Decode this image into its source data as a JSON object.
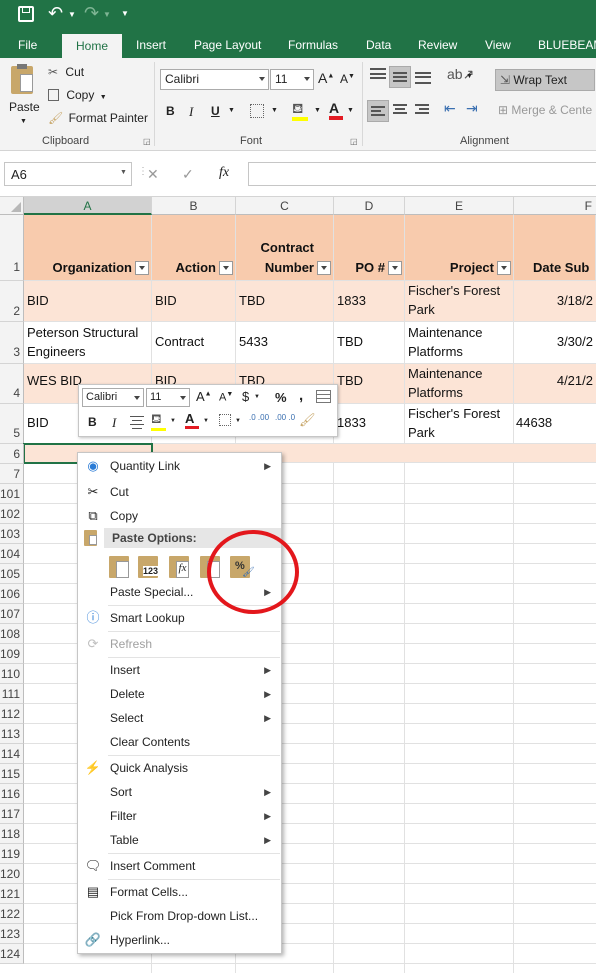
{
  "qat": {
    "save_icon": "save-icon",
    "undo_icon": "undo-icon",
    "redo_icon": "redo-icon",
    "customize_icon": "customize-icon"
  },
  "tabs": [
    "File",
    "Home",
    "Insert",
    "Page Layout",
    "Formulas",
    "Data",
    "Review",
    "View",
    "BLUEBEAM"
  ],
  "ribbon": {
    "clipboard": {
      "paste": "Paste",
      "cut": "Cut",
      "copy": "Copy",
      "format_painter": "Format Painter",
      "label": "Clipboard"
    },
    "font": {
      "font_name": "Calibri",
      "font_size": "11",
      "label": "Font",
      "bold": "B",
      "italic": "I",
      "underline": "U",
      "grow": "A",
      "shrink": "A",
      "font_color_letter": "A"
    },
    "alignment": {
      "wrap_text": "Wrap Text",
      "merge_center": "Merge & Cente",
      "label": "Alignment"
    }
  },
  "formula_bar": {
    "name_box": "A6",
    "fx": "fx",
    "cancel": "✕",
    "enter": "✓"
  },
  "columns": [
    "A",
    "B",
    "C",
    "D",
    "E",
    "F"
  ],
  "header_row": {
    "row": "1",
    "organization": "Organization",
    "action": "Action",
    "contract_number_1": "Contract",
    "contract_number_2": "Number",
    "po": "PO #",
    "project": "Project",
    "date_sub": "Date Sub"
  },
  "rows": [
    {
      "num": "2",
      "a": "BID",
      "b": "BID",
      "c": "TBD",
      "d": "1833",
      "e1": "Fischer's Forest",
      "e2": "Park",
      "f": "3/18/2"
    },
    {
      "num": "3",
      "a1": "Peterson Structural",
      "a2": "Engineers",
      "b": "Contract",
      "c": "5433",
      "d": "TBD",
      "e1": "Maintenance",
      "e2": "Platforms",
      "f": "3/30/2"
    },
    {
      "num": "4",
      "a": "WES BID",
      "b": "BID",
      "c": "TBD",
      "d": "TBD",
      "e1": "Maintenance",
      "e2": "Platforms",
      "f": "4/21/2"
    },
    {
      "num": "5",
      "a": "BID",
      "b": "",
      "c": "",
      "d": "1833",
      "e1": "Fischer's Forest",
      "e2": "Park",
      "f": "44638"
    }
  ],
  "row_numbers_after": [
    "6",
    "7",
    "101",
    "102",
    "103",
    "104",
    "105",
    "106",
    "107",
    "108",
    "109",
    "110",
    "111",
    "112",
    "113",
    "114",
    "115",
    "116",
    "117",
    "118",
    "119",
    "120",
    "121",
    "122",
    "123",
    "124"
  ],
  "mini_toolbar": {
    "font": "Calibri",
    "size": "11",
    "dollar": "$",
    "percent": "%",
    "comma": ",",
    "bold": "B",
    "italic": "I",
    "font_color": "A",
    "dec_inc": ".0 .00",
    "dec_dec": ".00 .0"
  },
  "context_menu": {
    "quantity_link": "Quantity Link",
    "cut": "Cut",
    "copy": "Copy",
    "paste_options": "Paste Options:",
    "paste_special": "Paste Special...",
    "smart_lookup": "Smart Lookup",
    "refresh": "Refresh",
    "insert": "Insert",
    "delete": "Delete",
    "select": "Select",
    "clear_contents": "Clear Contents",
    "quick_analysis": "Quick Analysis",
    "sort": "Sort",
    "filter": "Filter",
    "table": "Table",
    "insert_comment": "Insert Comment",
    "format_cells": "Format Cells...",
    "pick_dropdown": "Pick From Drop-down List...",
    "hyperlink": "Hyperlink..."
  },
  "colors": {
    "excel_green": "#217346",
    "header_fill": "#f8cbad",
    "row_band": "#fce4d6",
    "highlight_circle": "#e3171c"
  }
}
